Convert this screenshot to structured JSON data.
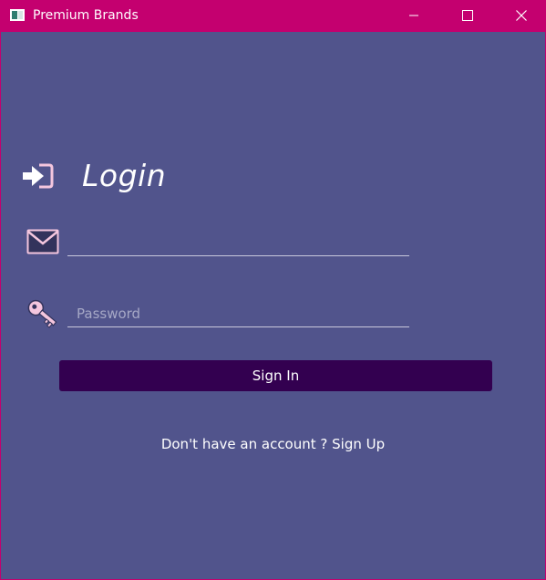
{
  "window": {
    "title": "Premium Brands",
    "minimize_icon": "minimize-icon",
    "maximize_icon": "maximize-icon",
    "close_icon": "close-icon"
  },
  "login": {
    "heading": "Login",
    "heading_icon": "login-arrow-icon",
    "email_icon": "envelope-icon",
    "email_value": "",
    "password_icon": "key-icon",
    "password_placeholder": "Password",
    "sign_in_label": "Sign In",
    "signup_prompt": "Don't have an account ?",
    "signup_link": "Sign Up"
  },
  "colors": {
    "titlebar": "#c4006f",
    "background": "#51548c",
    "button": "#330050",
    "icon_pink": "#f4c6de"
  }
}
